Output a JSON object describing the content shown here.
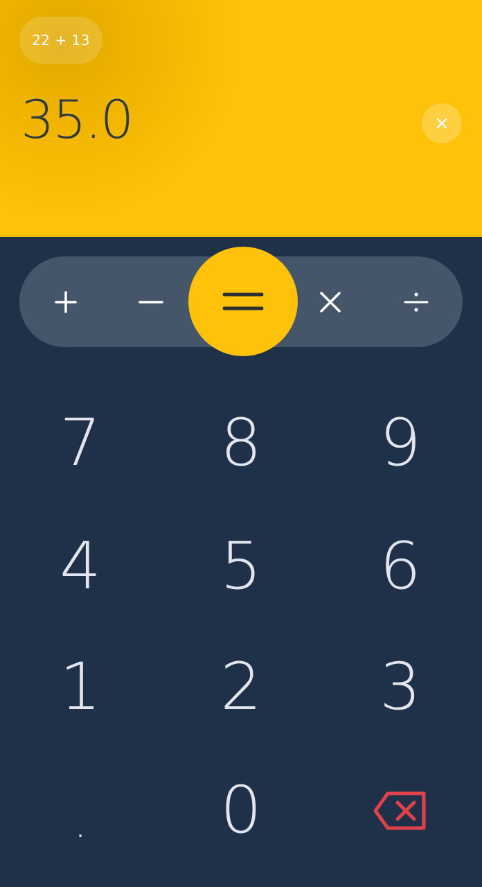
{
  "display": {
    "history_expression": "22 + 13",
    "result": "35.0",
    "clear_icon": "close-icon"
  },
  "operators": {
    "plus": "+",
    "minus": "−",
    "equals": "=",
    "times": "×",
    "divide": "÷"
  },
  "keypad": {
    "k7": "7",
    "k8": "8",
    "k9": "9",
    "k4": "4",
    "k5": "5",
    "k6": "6",
    "k1": "1",
    "k2": "2",
    "k3": "3",
    "dot": ".",
    "k0": "0",
    "backspace_icon": "backspace-icon"
  },
  "colors": {
    "display_bg": "#fec20b",
    "keypad_bg": "#1e3149",
    "operator_bar": "#46566a",
    "equals_bg": "#fec20b",
    "backspace": "#e0424b",
    "digit_text": "#e2e6ec"
  }
}
